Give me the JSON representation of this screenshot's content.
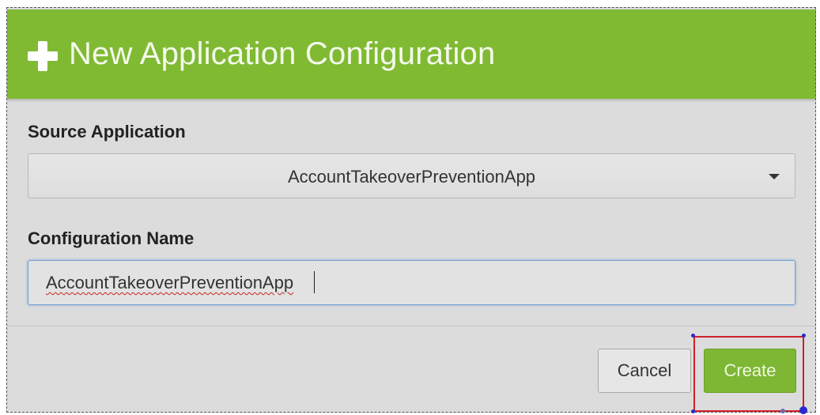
{
  "dialog": {
    "title": "New Application Configuration",
    "header_icon": "plus-icon",
    "accent_color": "#80ba33"
  },
  "source_application": {
    "label": "Source Application",
    "selected_value": "AccountTakeoverPreventionApp"
  },
  "configuration_name": {
    "label": "Configuration Name",
    "value": "AccountTakeoverPreventionApp"
  },
  "footer": {
    "cancel_label": "Cancel",
    "create_label": "Create"
  }
}
